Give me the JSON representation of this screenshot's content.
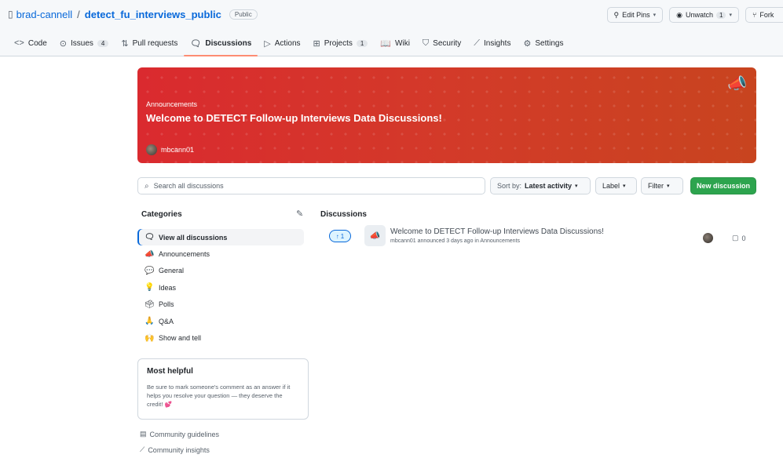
{
  "repo": {
    "owner": "brad-cannell",
    "separator": "/",
    "name": "detect_fu_interviews_public",
    "visibility": "Public"
  },
  "repo_actions": [
    {
      "label": "Edit Pins",
      "icon": "pin-icon",
      "caret": "▾"
    },
    {
      "label": "Unwatch",
      "count": "1",
      "icon": "eye-icon",
      "caret": "▾"
    },
    {
      "label": "Fork",
      "icon": "fork-icon"
    }
  ],
  "tabs": [
    {
      "label": "Code",
      "icon": "code-icon",
      "glyph": "<>"
    },
    {
      "label": "Issues",
      "count": "4",
      "icon": "issue-icon",
      "glyph": "⊙"
    },
    {
      "label": "Pull requests",
      "icon": "pull-request-icon",
      "glyph": "⇅"
    },
    {
      "label": "Discussions",
      "icon": "discussions-icon",
      "glyph": "🗨",
      "active": true
    },
    {
      "label": "Actions",
      "icon": "play-icon",
      "glyph": "▷"
    },
    {
      "label": "Projects",
      "count": "1",
      "icon": "table-icon",
      "glyph": "⊞"
    },
    {
      "label": "Wiki",
      "icon": "book-icon",
      "glyph": "📖"
    },
    {
      "label": "Security",
      "icon": "shield-icon",
      "glyph": "⛉"
    },
    {
      "label": "Insights",
      "icon": "graph-icon",
      "glyph": "⟋"
    },
    {
      "label": "Settings",
      "icon": "gear-icon",
      "glyph": "⚙"
    }
  ],
  "banner": {
    "category": "Announcements",
    "title": "Welcome to DETECT Follow-up Interviews Data Discussions!",
    "author": "mbcann01",
    "icon": "megaphone-icon",
    "glyph": "📣",
    "colors": {
      "start": "#da2a2f",
      "end": "#c8441f"
    }
  },
  "toolbar": {
    "search_placeholder": "Search all discussions",
    "sort_prefix": "Sort by:",
    "sort_value": "Latest activity",
    "label_btn": "Label",
    "filter_btn": "Filter",
    "new_btn": "New discussion",
    "accent": "#2da44e"
  },
  "categories": {
    "heading": "Categories",
    "items": [
      {
        "label": "View all discussions",
        "glyph": "🗨",
        "icon": "discussions-icon",
        "active": true
      },
      {
        "label": "Announcements",
        "glyph": "📣",
        "icon": "megaphone-icon"
      },
      {
        "label": "General",
        "glyph": "💬",
        "icon": "speech-bubble-icon"
      },
      {
        "label": "Ideas",
        "glyph": "💡",
        "icon": "lightbulb-icon"
      },
      {
        "label": "Polls",
        "glyph": "🗳",
        "icon": "ballot-box-icon"
      },
      {
        "label": "Q&A",
        "glyph": "🙏",
        "icon": "praying-hands-icon"
      },
      {
        "label": "Show and tell",
        "glyph": "🙌",
        "icon": "raised-hands-icon"
      }
    ]
  },
  "most_helpful": {
    "title": "Most helpful",
    "text": "Be sure to mark someone's comment as an answer if it helps you resolve your question — they deserve the credit! 💕"
  },
  "community": {
    "guidelines": "Community guidelines",
    "insights": "Community insights"
  },
  "discussions": {
    "heading": "Discussions",
    "items": [
      {
        "votes": "1",
        "glyph": "📣",
        "title": "Welcome to DETECT Follow-up Interviews Data Discussions!",
        "meta": "mbcann01 announced 3 days ago in Announcements",
        "comments": "0"
      }
    ]
  }
}
